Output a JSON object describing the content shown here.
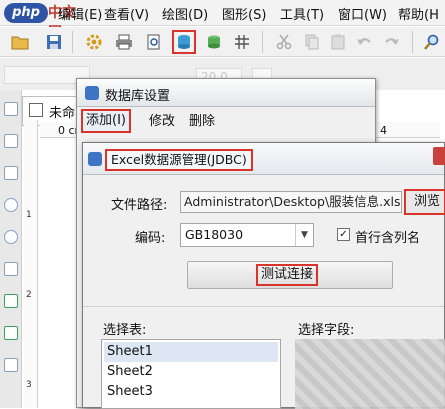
{
  "branding": {
    "logo_badge": "php",
    "logo_text": "中文网"
  },
  "menu": {
    "items": [
      "编辑(E)",
      "查看(V)",
      "绘图(D)",
      "图形(S)",
      "工具(T)",
      "窗口(W)",
      "帮助(H"
    ]
  },
  "toolbar": {
    "icons": [
      "folder-icon",
      "save-icon",
      "gear-icon",
      "printer-icon",
      "preview-icon",
      "database-icon",
      "database-stack-icon",
      "grid-icon",
      "cut-icon",
      "copy-icon",
      "paste-icon",
      "undo-icon",
      "redo-icon",
      "search-icon"
    ],
    "selected": "database-icon"
  },
  "format_bar": {
    "font_size": "20.0"
  },
  "ruler": {
    "origin_label": "0 cm",
    "h_ticks": [
      "4"
    ],
    "v_ticks": [
      "1",
      "2",
      "3"
    ]
  },
  "document": {
    "tab_label": "未命"
  },
  "db_window": {
    "title": "数据库设置",
    "menu_add": "添加(I)",
    "menu_edit": "修改",
    "menu_delete": "删除"
  },
  "excel_dialog": {
    "title": "Excel数据源管理(JDBC)",
    "path_label": "文件路径:",
    "path_value": "Administrator\\Desktop\\服装信息.xls",
    "browse_label": "浏览",
    "encoding_label": "编码:",
    "encoding_value": "GB18030",
    "first_row_checked": "✓",
    "first_row_label": "首行含列名",
    "test_button": "测试连接",
    "sheet_label": "选择表:",
    "field_label": "选择字段:",
    "sheets": [
      "Sheet1",
      "Sheet2",
      "Sheet3"
    ]
  },
  "colors": {
    "highlight": "#d9342b",
    "accent": "#3d74c4"
  }
}
